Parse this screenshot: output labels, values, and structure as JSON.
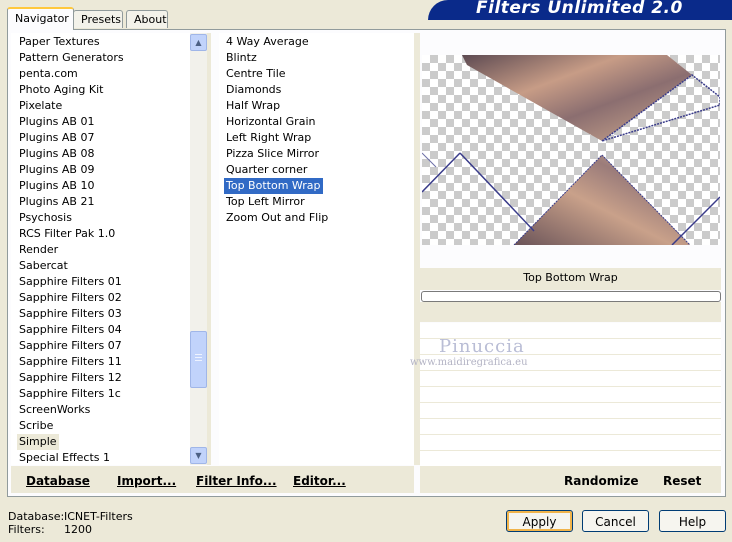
{
  "tabs": [
    "Navigator",
    "Presets",
    "About"
  ],
  "app_title": "Filters Unlimited 2.0",
  "categories": [
    "Paper Textures",
    "Pattern Generators",
    "penta.com",
    "Photo Aging Kit",
    "Pixelate",
    "Plugins AB 01",
    "Plugins AB 07",
    "Plugins AB 08",
    "Plugins AB 09",
    "Plugins AB 10",
    "Plugins AB 21",
    "Psychosis",
    "RCS Filter Pak 1.0",
    "Render",
    "Sabercat",
    "Sapphire Filters 01",
    "Sapphire Filters 02",
    "Sapphire Filters 03",
    "Sapphire Filters 04",
    "Sapphire Filters 07",
    "Sapphire Filters 11",
    "Sapphire Filters 12",
    "Sapphire Filters 1c",
    "ScreenWorks",
    "Scribe",
    "Simple",
    "Special Effects 1"
  ],
  "filters": [
    "4 Way Average",
    "Blintz",
    "Centre Tile",
    "Diamonds",
    "Half Wrap",
    "Horizontal Grain",
    "Left Right Wrap",
    "Pizza Slice Mirror",
    "Quarter corner",
    "Top Bottom Wrap",
    "Top Left Mirror",
    "Zoom Out and Flip"
  ],
  "selected_filter": "Top Bottom Wrap",
  "selected_category": "Simple",
  "watermark": {
    "name": "Pinuccia",
    "url": "www.maidiregrafica.eu"
  },
  "buttons": {
    "database": "Database",
    "import": "Import...",
    "filter_info": "Filter Info...",
    "editor": "Editor...",
    "randomize": "Randomize",
    "reset": "Reset",
    "apply": "Apply",
    "cancel": "Cancel",
    "help": "Help"
  },
  "status": {
    "database_label": "Database:",
    "database_value": "ICNET-Filters",
    "filters_label": "Filters:",
    "filters_value": "1200"
  },
  "colors": {
    "selection": "#316ac5",
    "title_banner": "#0a2a8a",
    "checker": "#cbcbcb"
  }
}
